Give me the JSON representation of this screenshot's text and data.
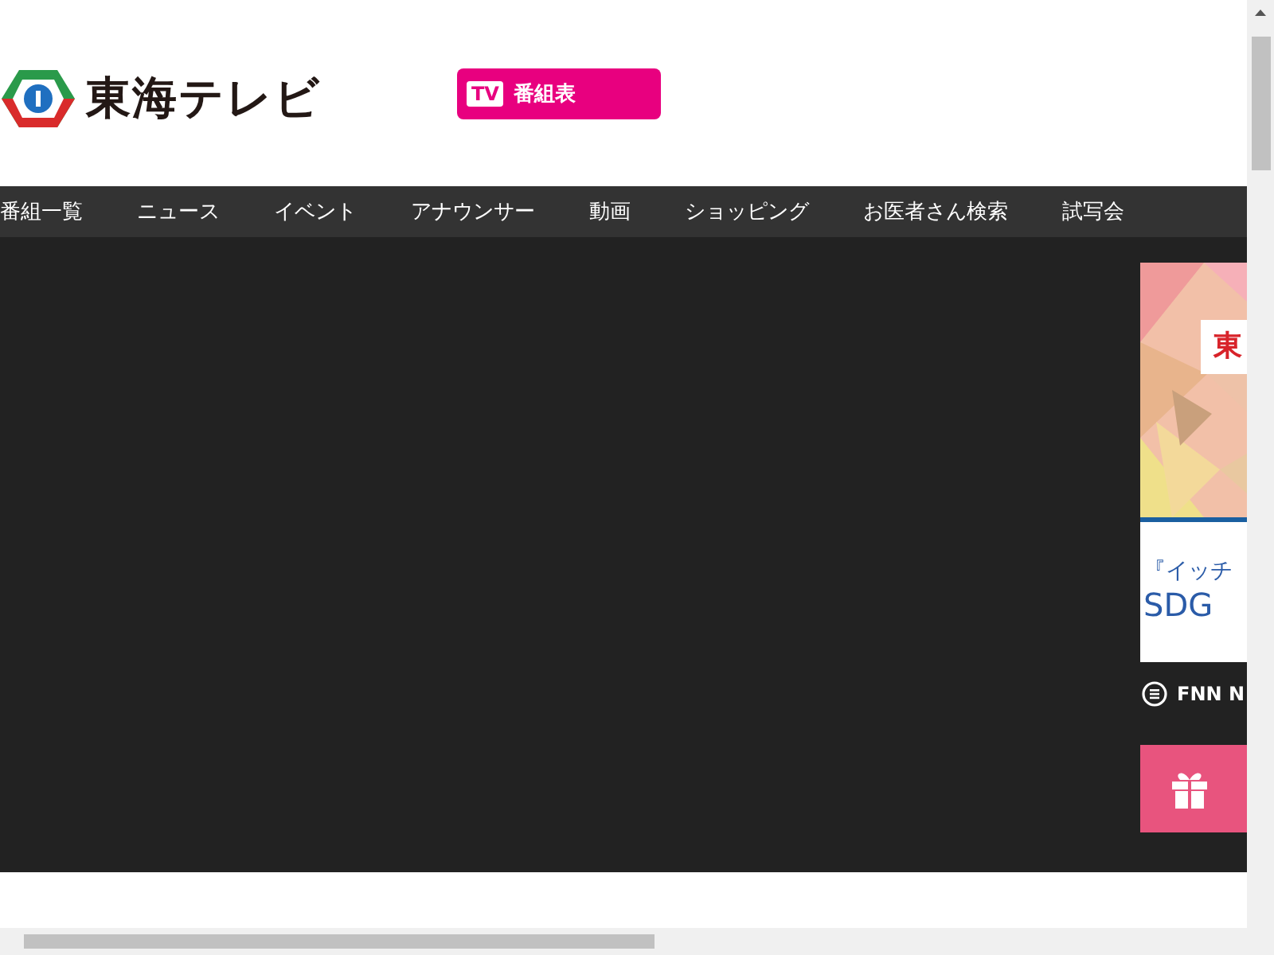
{
  "header": {
    "logo_text": "東海テレビ",
    "tv_badge": "TV",
    "schedule_button": "番組表"
  },
  "nav": [
    {
      "label": "番組一覧"
    },
    {
      "label": "ニュース"
    },
    {
      "label": "イベント"
    },
    {
      "label": "アナウンサー"
    },
    {
      "label": "動画"
    },
    {
      "label": "ショッピング"
    },
    {
      "label": "お医者さん検索"
    },
    {
      "label": "試写会"
    }
  ],
  "sidebar": {
    "banner": {
      "kind": "picture",
      "badge": "東"
    },
    "banner_caption": [
      "『イッチ",
      "SDG"
    ],
    "news_link": "FNN N"
  }
}
